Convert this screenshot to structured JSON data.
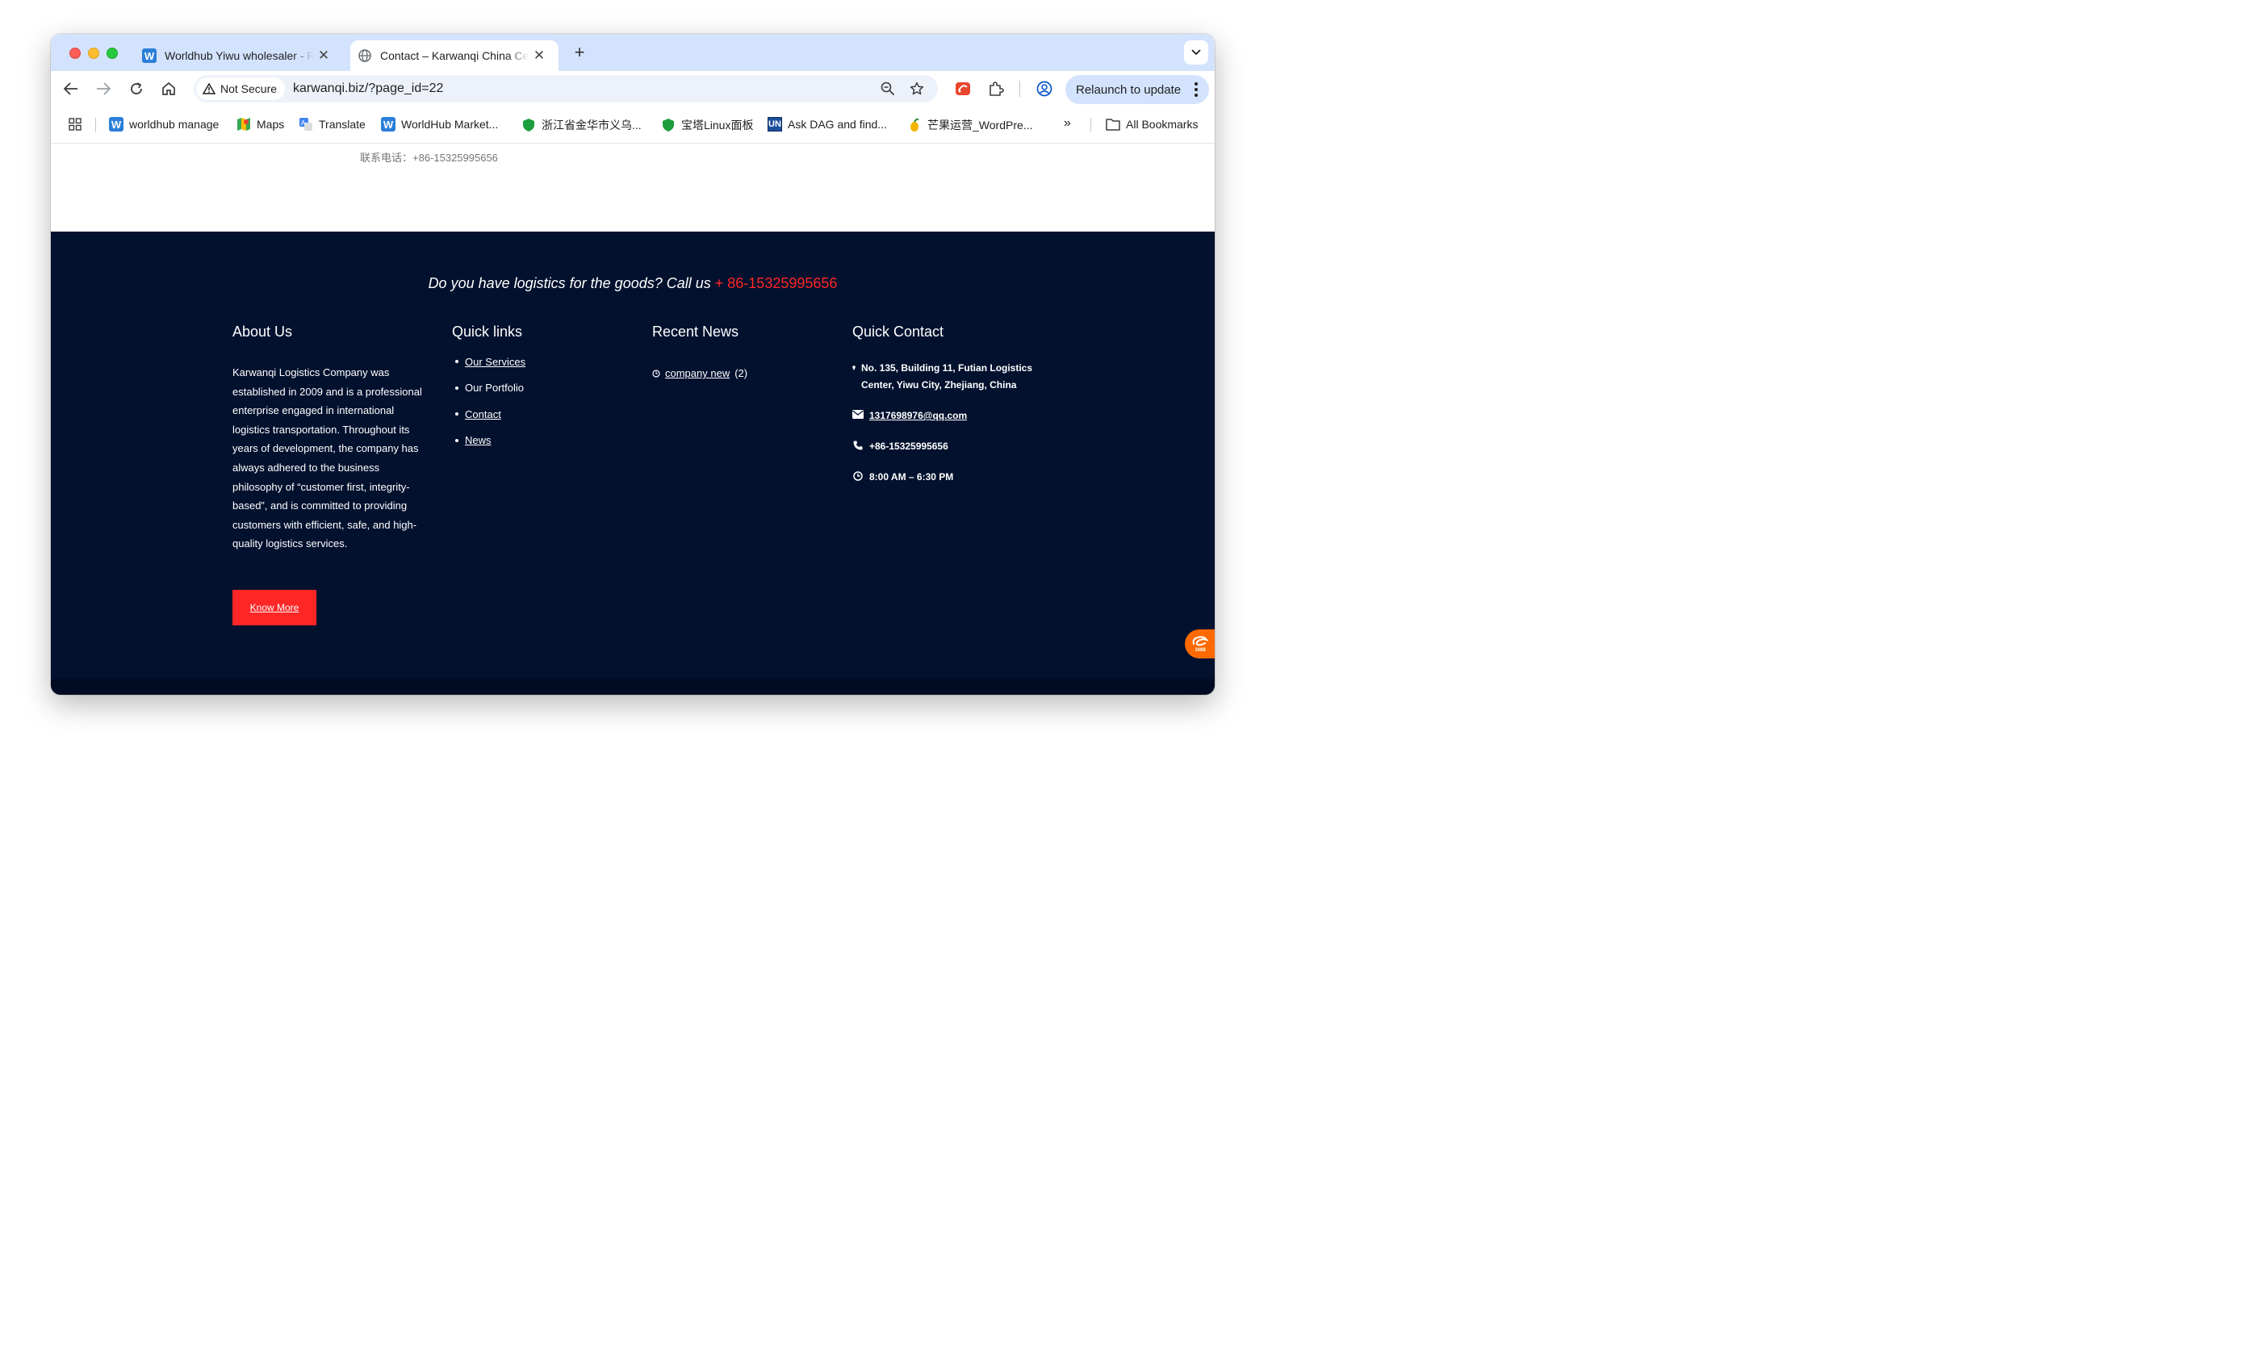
{
  "browser": {
    "tabs": [
      {
        "title": "Worldhub Yiwu wholesaler - R",
        "active": false
      },
      {
        "title": "Contact – Karwanqi China Ce",
        "active": true
      }
    ],
    "security_label": "Not Secure",
    "url": "karwanqi.biz/?page_id=22",
    "relaunch_label": "Relaunch to update",
    "bookmarks": [
      {
        "label": "worldhub manage",
        "icon": "w-icon"
      },
      {
        "label": "Maps",
        "icon": "maps-icon"
      },
      {
        "label": "Translate",
        "icon": "translate-icon"
      },
      {
        "label": "WorldHub Market...",
        "icon": "w-icon"
      },
      {
        "label": "浙江省金华市义乌...",
        "icon": "shield-icon"
      },
      {
        "label": "宝塔Linux面板",
        "icon": "shield-icon"
      },
      {
        "label": "Ask DAG and find...",
        "icon": "un-icon"
      },
      {
        "label": "芒果运营_WordPre...",
        "icon": "mango-icon"
      }
    ],
    "all_bookmarks_label": "All Bookmarks"
  },
  "page": {
    "top_phone": "联系电话：+86-15325995656",
    "cta_text": "Do you have logistics for the goods? Call us ",
    "cta_phone": "+ 86-15325995656",
    "about": {
      "title": "About Us",
      "text": "Karwanqi Logistics Company was established in 2009 and is a professional enterprise engaged in international logistics transportation. Throughout its years of development, the company has always adhered to the business philosophy of “customer first, integrity-based”, and is committed to providing customers with efficient, safe, and high-quality logistics services.",
      "button": "Know More"
    },
    "quick_links": {
      "title": "Quick links",
      "items": [
        "Our Services",
        "Our Portfolio",
        "Contact",
        "News"
      ]
    },
    "recent_news": {
      "title": "Recent News",
      "item_label": "company new",
      "item_count": "(2)"
    },
    "quick_contact": {
      "title": "Quick Contact",
      "address_line1": "No. 135, Building 11, Futian Logistics",
      "address_line2": "Center, Yiwu City, Zhejiang, China",
      "email": "1317698976@qq.com",
      "phone": "+86-15325995656",
      "hours": "8:00 AM – 6:30 PM"
    },
    "badge_text": "1688"
  },
  "colors": {
    "footer_bg": "#02112e",
    "accent_red": "#ff2626",
    "tab_strip": "#d3e3fd",
    "omnibox": "#edf2fa"
  }
}
